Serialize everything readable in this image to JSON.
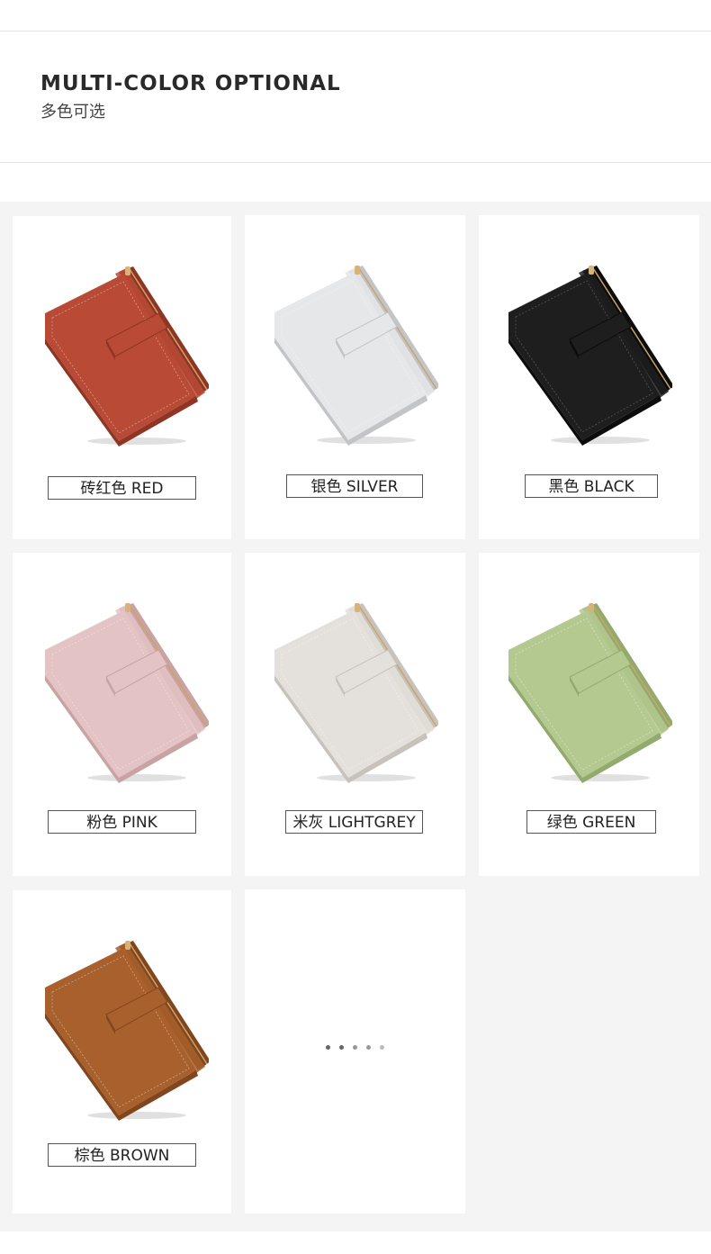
{
  "header": {
    "title": "MULTI-COLOR OPTIONAL",
    "subtitle": "多色可选"
  },
  "products": [
    {
      "label": "砖红色 RED",
      "color": "#b84a36",
      "shade": "#8e3523",
      "icon": "wallet-red"
    },
    {
      "label": "银色 SILVER",
      "color": "#e6e7e9",
      "shade": "#c2c4c8",
      "icon": "wallet-silver"
    },
    {
      "label": "黑色 BLACK",
      "color": "#1e1e1e",
      "shade": "#0c0c0c",
      "icon": "wallet-black"
    },
    {
      "label": "粉色 PINK",
      "color": "#e3c3c4",
      "shade": "#c9a2a4",
      "icon": "wallet-pink"
    },
    {
      "label": "米灰 LIGHTGREY",
      "color": "#e4e0db",
      "shade": "#c7c2bc",
      "icon": "wallet-lightgrey"
    },
    {
      "label": "绿色 GREEN",
      "color": "#b4c98f",
      "shade": "#93aa6d",
      "icon": "wallet-green"
    },
    {
      "label": "棕色 BROWN",
      "color": "#a8602d",
      "shade": "#82461e",
      "icon": "wallet-brown"
    }
  ],
  "pager": {
    "dots": 5
  }
}
